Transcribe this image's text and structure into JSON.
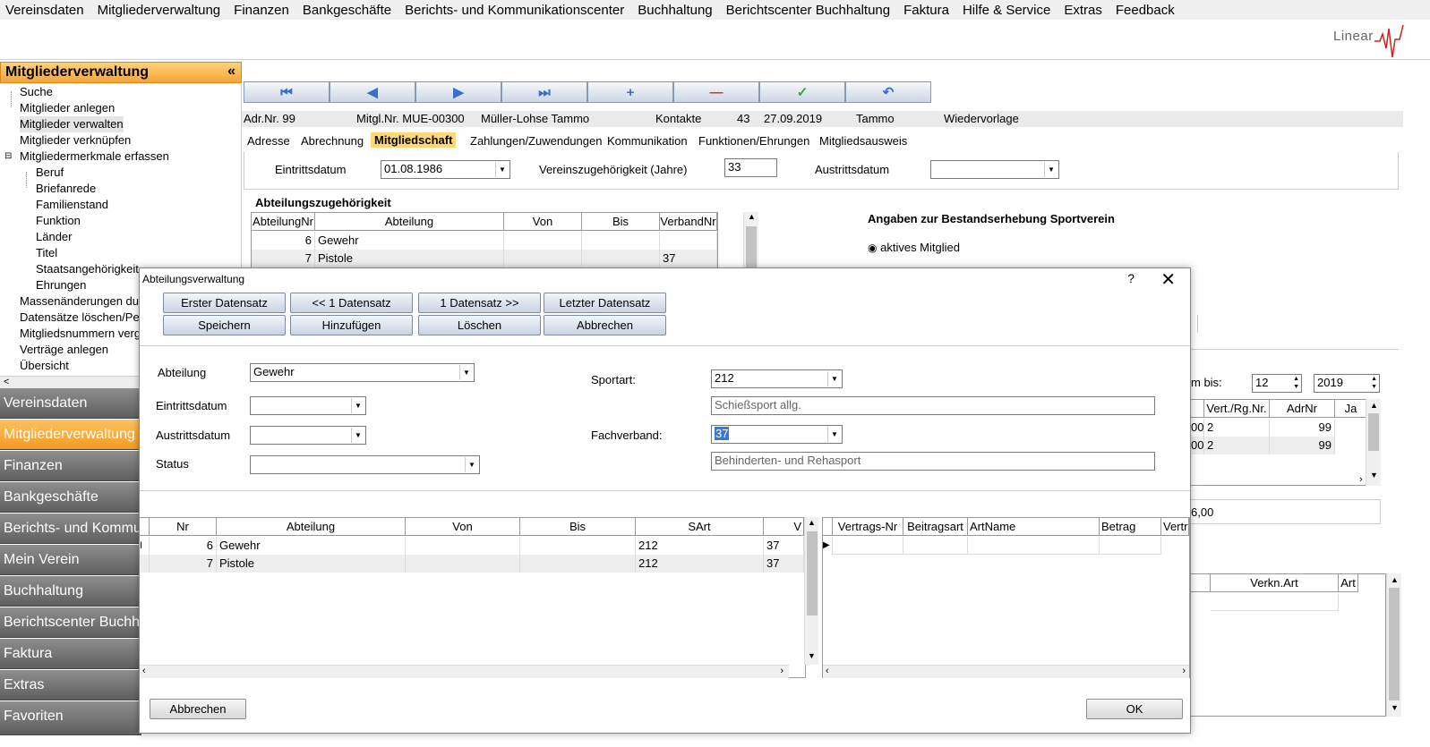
{
  "menu": [
    "Vereinsdaten",
    "Mitgliederverwaltung",
    "Finanzen",
    "Bankgeschäfte",
    "Berichts- und Kommunikationscenter",
    "Buchhaltung",
    "Berichtscenter Buchhaltung",
    "Faktura",
    "Hilfe & Service",
    "Extras",
    "Feedback"
  ],
  "logo": "Linear",
  "left_panel": {
    "title": "Mitgliederverwaltung",
    "collapse": "«",
    "tree": [
      "Suche",
      "Mitglieder anlegen",
      "Mitglieder verwalten",
      "Mitglieder verknüpfen",
      "Mitgliedermerkmale erfassen",
      "Beruf",
      "Briefanrede",
      "Familienstand",
      "Funktion",
      "Länder",
      "Titel",
      "Staatsangehörigkeit",
      "Ehrungen",
      "Massenänderungen dur",
      "Datensätze löschen/Pe",
      "Mitgliedsnummern verge",
      "Verträge anlegen",
      "Übersicht"
    ],
    "scroll_left": "<",
    "nav": [
      "Vereinsdaten",
      "Mitgliederverwaltung",
      "Finanzen",
      "Bankgeschäfte",
      "Berichts- und Kommun",
      "Mein Verein",
      "Buchhaltung",
      "Berichtscenter Buchha",
      "Faktura",
      "Extras",
      "Favoriten"
    ]
  },
  "toolbar": [
    "⏮",
    "◀",
    "▶",
    "⏭",
    "+",
    "—",
    "✓",
    "↶"
  ],
  "infobar": {
    "adr": "Adr.Nr. 99",
    "mitgl": "Mitgl.Nr. MUE-00300",
    "name": "Müller-Lohse Tammo",
    "kontakte_label": "Kontakte",
    "kontakte": "43",
    "date": "27.09.2019",
    "user": "Tammo",
    "wiedervorlage": "Wiedervorlage"
  },
  "tabs": [
    "Adresse",
    "Abrechnung",
    "Mitgliedschaft",
    "Zahlungen/Zuwendungen",
    "Kommunikation",
    "Funktionen/Ehrungen",
    "Mitgliedsausweis"
  ],
  "mitgliedschaft": {
    "eintritt_label": "Eintrittsdatum",
    "eintritt_value": "01.08.1986",
    "zugehoerigkeit_label": "Vereinszugehörigkeit (Jahre)",
    "zugehoerigkeit_value": "33",
    "austritt_label": "Austrittsdatum",
    "abt_title": "Abteilungszugehörigkeit",
    "abt_headers": [
      "AbteilungNr",
      "Abteilung",
      "Von",
      "Bis",
      "VerbandNr"
    ],
    "abt_rows": [
      [
        "6",
        "Gewehr",
        "",
        "",
        ""
      ],
      [
        "7",
        "Pistole",
        "",
        "",
        "37"
      ]
    ],
    "bestand_title": "Angaben zur Bestandserhebung Sportverein",
    "bestand_option": "aktives Mitglied",
    "bis_label": "m bis:",
    "bis_month": "12",
    "bis_year": "2019",
    "vert_headers": [
      "Vert./Rg.Nr.",
      "AdrNr",
      "Ja"
    ],
    "vert_rows": [
      [
        "00",
        "2",
        "99"
      ],
      [
        "00",
        "2",
        "99"
      ]
    ],
    "sum_tail": "6,00",
    "verkn_headers": [
      "Verkn.Art",
      "Art"
    ]
  },
  "dialog": {
    "title": "Abteilungsverwaltung",
    "help": "?",
    "close": "✕",
    "buttons_row1": [
      "Erster Datensatz",
      "<< 1 Datensatz",
      "1 Datensatz >>",
      "Letzter Datensatz"
    ],
    "buttons_row2": [
      "Speichern",
      "Hinzufügen",
      "Löschen",
      "Abbrechen"
    ],
    "abteilung_label": "Abteilung",
    "abteilung_value": "Gewehr",
    "eintritt_label": "Eintrittsdatum",
    "austritt_label": "Austrittsdatum",
    "status_label": "Status",
    "sportart_label": "Sportart:",
    "sportart_value": "212",
    "sportart_desc": "Schießsport allg.",
    "fachverband_label": "Fachverband:",
    "fachverband_value": "37",
    "fachverband_desc": "Behinderten- und Rehasport",
    "grid_headers": [
      "Nr",
      "Abteilung",
      "Von",
      "Bis",
      "SArt",
      "V"
    ],
    "grid_rows": [
      [
        "6",
        "Gewehr",
        "",
        "",
        "212",
        "37"
      ],
      [
        "7",
        "Pistole",
        "",
        "",
        "212",
        "37"
      ]
    ],
    "grid2_headers": [
      "Vertrags-Nr",
      "Beitragsart",
      "ArtName",
      "Betrag",
      "Vertra"
    ],
    "cancel_button": "Abbrechen",
    "ok_button": "OK"
  }
}
